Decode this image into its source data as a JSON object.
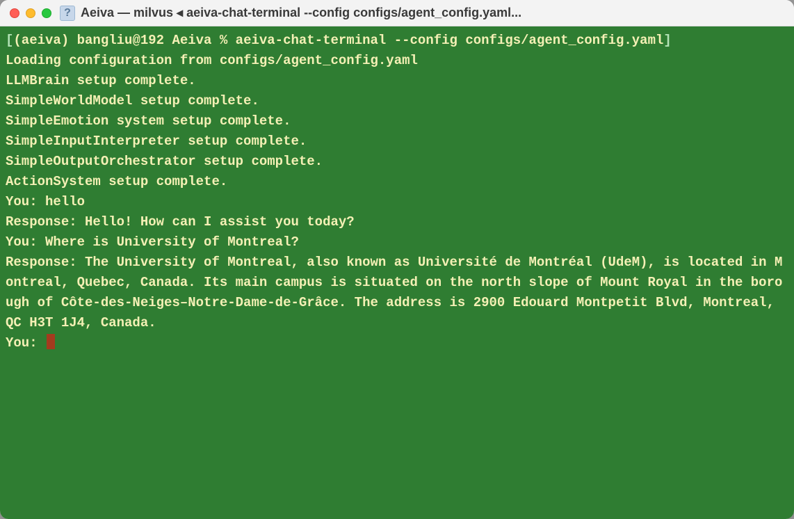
{
  "window": {
    "title": "Aeiva — milvus ◂ aeiva-chat-terminal --config configs/agent_config.yaml...",
    "icon_glyph": "?"
  },
  "terminal": {
    "bracket_open": "[",
    "bracket_close": "]",
    "prompt_env": "(aeiva) ",
    "prompt_userhost": "bangliu@192 Aeiva % ",
    "command": "aeiva-chat-terminal --config configs/agent_config.yaml",
    "lines": {
      "l0": "Loading configuration from configs/agent_config.yaml",
      "l1": "LLMBrain setup complete.",
      "l2": "SimpleWorldModel setup complete.",
      "l3": "SimpleEmotion system setup complete.",
      "l4": "SimpleInputInterpreter setup complete.",
      "l5": "SimpleOutputOrchestrator setup complete.",
      "l6": "ActionSystem setup complete.",
      "l7": "You: hello",
      "l8": "Response: Hello! How can I assist you today?",
      "l9": "You: Where is University of Montreal?",
      "l10": "Response: The University of Montreal, also known as Université de Montréal (UdeM), is located in Montreal, Quebec, Canada. Its main campus is situated on the north slope of Mount Royal in the borough of Côte-des-Neiges–Notre-Dame-de-Grâce. The address is 2900 Edouard Montpetit Blvd, Montreal, QC H3T 1J4, Canada.",
      "l11_prefix": "You: "
    }
  }
}
